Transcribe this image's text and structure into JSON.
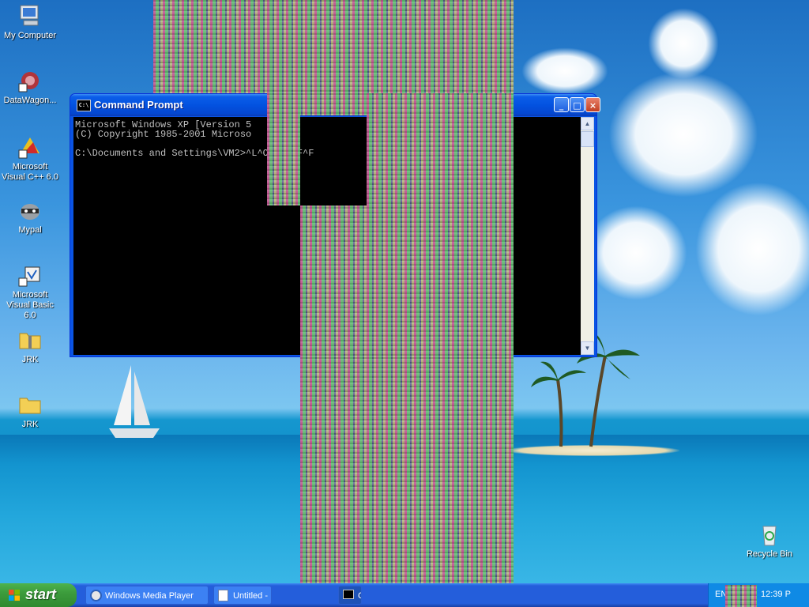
{
  "desktop": {
    "icons": [
      {
        "label": "My Computer",
        "icon": "my-computer-icon"
      },
      {
        "label": "DataWagon...",
        "icon": "datawagon-icon"
      },
      {
        "label": "Microsoft Visual C++ 6.0",
        "icon": "visual-cpp-icon"
      },
      {
        "label": "Mypal",
        "icon": "mypal-raccoon-icon"
      },
      {
        "label": "Microsoft Visual Basic 6.0",
        "icon": "visual-basic-icon"
      },
      {
        "label": "JRK",
        "icon": "zip-folder-icon"
      },
      {
        "label": "JRK",
        "icon": "folder-icon"
      },
      {
        "label": "Recycle Bin",
        "icon": "recycle-bin-icon"
      }
    ]
  },
  "window": {
    "title": "Command Prompt",
    "icon": "cmd-icon",
    "console_lines": [
      "Microsoft Windows XP [Version 5",
      "(C) Copyright 1985-2001 Microso",
      "",
      "C:\\Documents and Settings\\VM2>^L^O^G^O^F^F"
    ],
    "controls": {
      "minimize": "_",
      "maximize": "□",
      "close": "×"
    }
  },
  "taskbar": {
    "start_label": "start",
    "tasks": [
      {
        "label": "Windows Media Player",
        "icon": "media-player-icon"
      },
      {
        "label": "Untitled -",
        "icon": "notepad-icon"
      },
      {
        "label": "C",
        "icon": "cmd-icon"
      }
    ],
    "tray": {
      "language": "EN",
      "clock": "12:39 P"
    }
  },
  "colors": {
    "titlebar": "#0352e0",
    "taskbar": "#245edb",
    "start": "#3c9c3c",
    "console_text": "#c0c0c0"
  }
}
